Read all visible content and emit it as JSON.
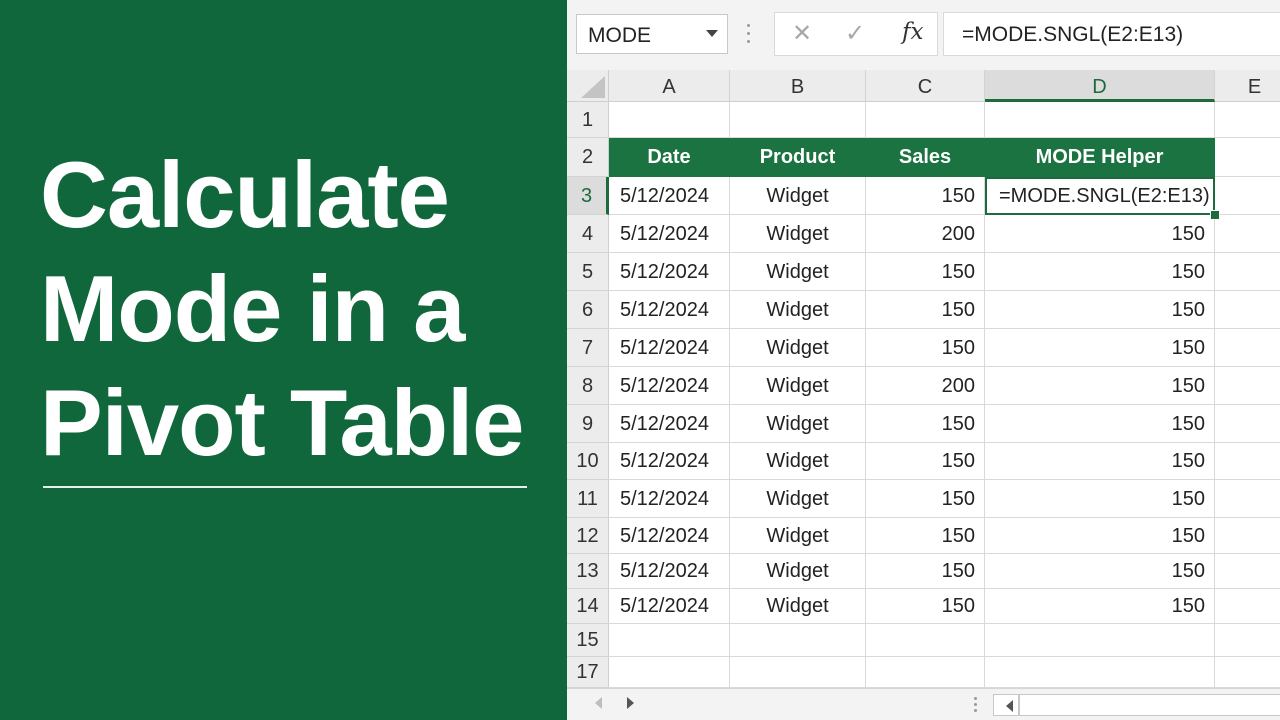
{
  "title_lines": [
    "Calculate",
    "Mode in a",
    "Pivot Table"
  ],
  "formula_bar": {
    "name_box": "MODE",
    "cancel_icon": "✕",
    "enter_icon": "✓",
    "fx_label": "fx",
    "formula": "=MODE.SNGL(E2:E13)"
  },
  "columns": [
    "A",
    "B",
    "C",
    "D",
    "E"
  ],
  "selected_column": "D",
  "selected_row": "3",
  "row_numbers": [
    "1",
    "2",
    "3",
    "4",
    "5",
    "6",
    "7",
    "8",
    "9",
    "10",
    "11",
    "12",
    "13",
    "14",
    "15",
    "17"
  ],
  "table_header": [
    "Date",
    "Product",
    "Sales",
    "MODE Helper"
  ],
  "rows": [
    [
      "5/12/2024",
      "Widget",
      "150",
      "=MODE.SNGL(E2:E13)"
    ],
    [
      "5/12/2024",
      "Widget",
      "200",
      "150"
    ],
    [
      "5/12/2024",
      "Widget",
      "150",
      "150"
    ],
    [
      "5/12/2024",
      "Widget",
      "150",
      "150"
    ],
    [
      "5/12/2024",
      "Widget",
      "150",
      "150"
    ],
    [
      "5/12/2024",
      "Widget",
      "200",
      "150"
    ],
    [
      "5/12/2024",
      "Widget",
      "150",
      "150"
    ],
    [
      "5/12/2024",
      "Widget",
      "150",
      "150"
    ],
    [
      "5/12/2024",
      "Widget",
      "150",
      "150"
    ],
    [
      "5/12/2024",
      "Widget",
      "150",
      "150"
    ],
    [
      "5/12/2024",
      "Widget",
      "150",
      "150"
    ],
    [
      "5/12/2024",
      "Widget",
      "150",
      "150"
    ]
  ],
  "colors": {
    "panel_green": "#10673b",
    "header_green": "#1a7340",
    "selection_green": "#1d6b3c"
  }
}
